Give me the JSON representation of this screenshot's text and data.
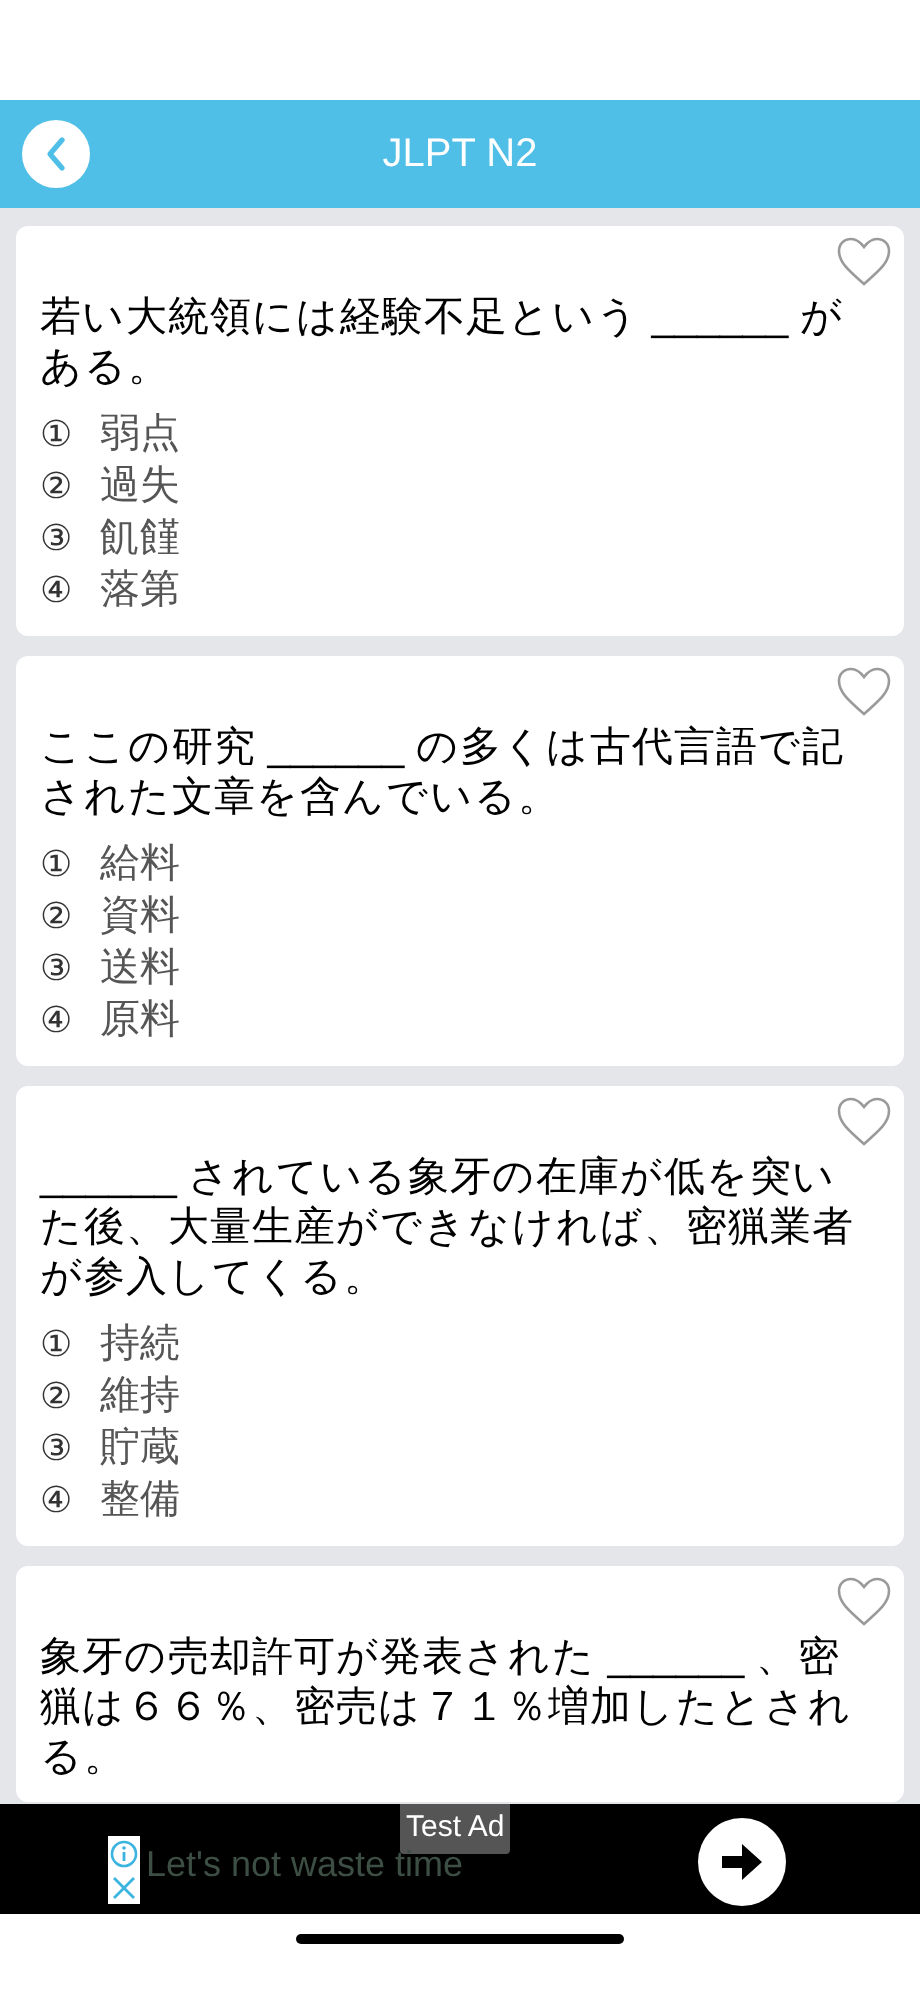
{
  "header": {
    "title": "JLPT N2"
  },
  "questions": [
    {
      "text": "若い大統領には経験不足という ______ がある。",
      "favorite": false,
      "options": [
        {
          "marker": "①",
          "text": "弱点"
        },
        {
          "marker": "②",
          "text": "過失"
        },
        {
          "marker": "③",
          "text": "飢饉"
        },
        {
          "marker": "④",
          "text": "落第"
        }
      ]
    },
    {
      "text": "ここの研究 ______ の多くは古代言語で記された文章を含んでいる。",
      "favorite": false,
      "options": [
        {
          "marker": "①",
          "text": "給料"
        },
        {
          "marker": "②",
          "text": "資料"
        },
        {
          "marker": "③",
          "text": "送料"
        },
        {
          "marker": "④",
          "text": "原料"
        }
      ]
    },
    {
      "text": "______ されている象牙の在庫が低を突いた後、大量生産ができなければ、密猟業者が参入してくる。",
      "favorite": false,
      "options": [
        {
          "marker": "①",
          "text": "持続"
        },
        {
          "marker": "②",
          "text": "維持"
        },
        {
          "marker": "③",
          "text": "貯蔵"
        },
        {
          "marker": "④",
          "text": "整備"
        }
      ]
    },
    {
      "text": "象牙の売却許可が発表された ______ 、密猟は６６％、密売は７１％増加したとされる。",
      "favorite": false
    }
  ],
  "ad": {
    "badge": "Test Ad",
    "text": "Let's not waste time"
  }
}
